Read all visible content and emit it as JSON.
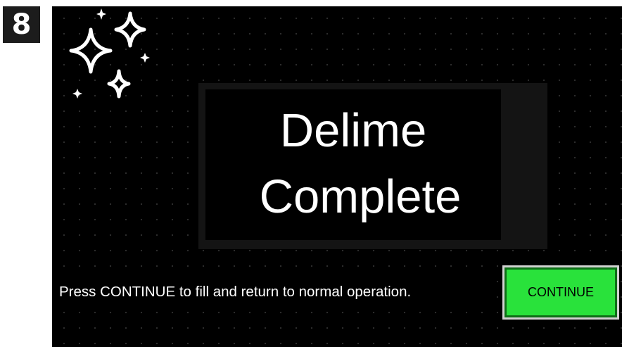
{
  "step_badge": "8",
  "screen": {
    "title_line1": "Delime",
    "title_line2": "Complete",
    "instruction": "Press CONTINUE to fill and return to normal operation.",
    "continue_button": "CONTINUE",
    "decoration_icon": "sparkles-icon"
  },
  "colors": {
    "screen_background": "#000000",
    "continue_button": "#29e23b",
    "text": "#ffffff"
  }
}
